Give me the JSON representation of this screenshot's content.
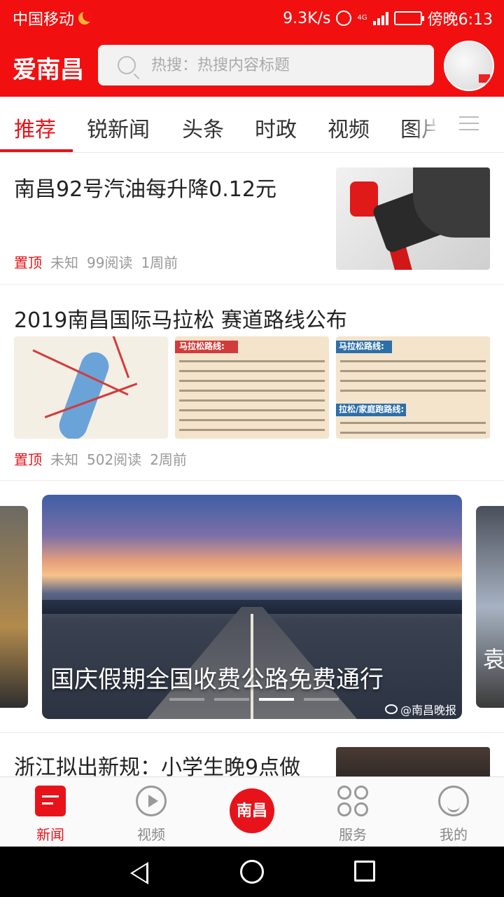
{
  "status_bar": {
    "carrier": "中国移动",
    "speed": "9.3K/s",
    "network": "4G",
    "time": "傍晚6:13"
  },
  "header": {
    "logo": "爱南昌",
    "search_placeholder": "热搜：热搜内容标题"
  },
  "tabs": [
    "推荐",
    "锐新闻",
    "头条",
    "时政",
    "视频",
    "图片"
  ],
  "news": [
    {
      "title": "南昌92号汽油每升降0.12元",
      "pin": "置顶",
      "source": "未知",
      "reads": "99阅读",
      "time": "1周前"
    },
    {
      "title": "2019南昌国际马拉松 赛道路线公布",
      "pin": "置顶",
      "source": "未知",
      "reads": "502阅读",
      "time": "2周前",
      "thumb_labels": [
        "马拉松路线:",
        "马拉松路线:",
        "拉松/家庭跑路线:"
      ]
    }
  ],
  "carousel": {
    "caption": "国庆假期全国收费公路免费通行",
    "watermark": "@南昌晚报",
    "side_text": "袁",
    "active_dot": 2,
    "dot_count": 4
  },
  "partial_news": {
    "title": "浙江拟出新规：小学生晚9点做"
  },
  "bottom_nav": {
    "items": [
      {
        "label": "新闻",
        "icon": "news-icon",
        "active": true
      },
      {
        "label": "视频",
        "icon": "play-icon",
        "active": false
      },
      {
        "label": "南昌",
        "icon": "nanchang-logo-icon",
        "active": false
      },
      {
        "label": "服务",
        "icon": "service-grid-icon",
        "active": false
      },
      {
        "label": "我的",
        "icon": "profile-icon",
        "active": false
      }
    ]
  },
  "colors": {
    "brand_red": "#f20f0f",
    "accent_red": "#e8131a"
  }
}
